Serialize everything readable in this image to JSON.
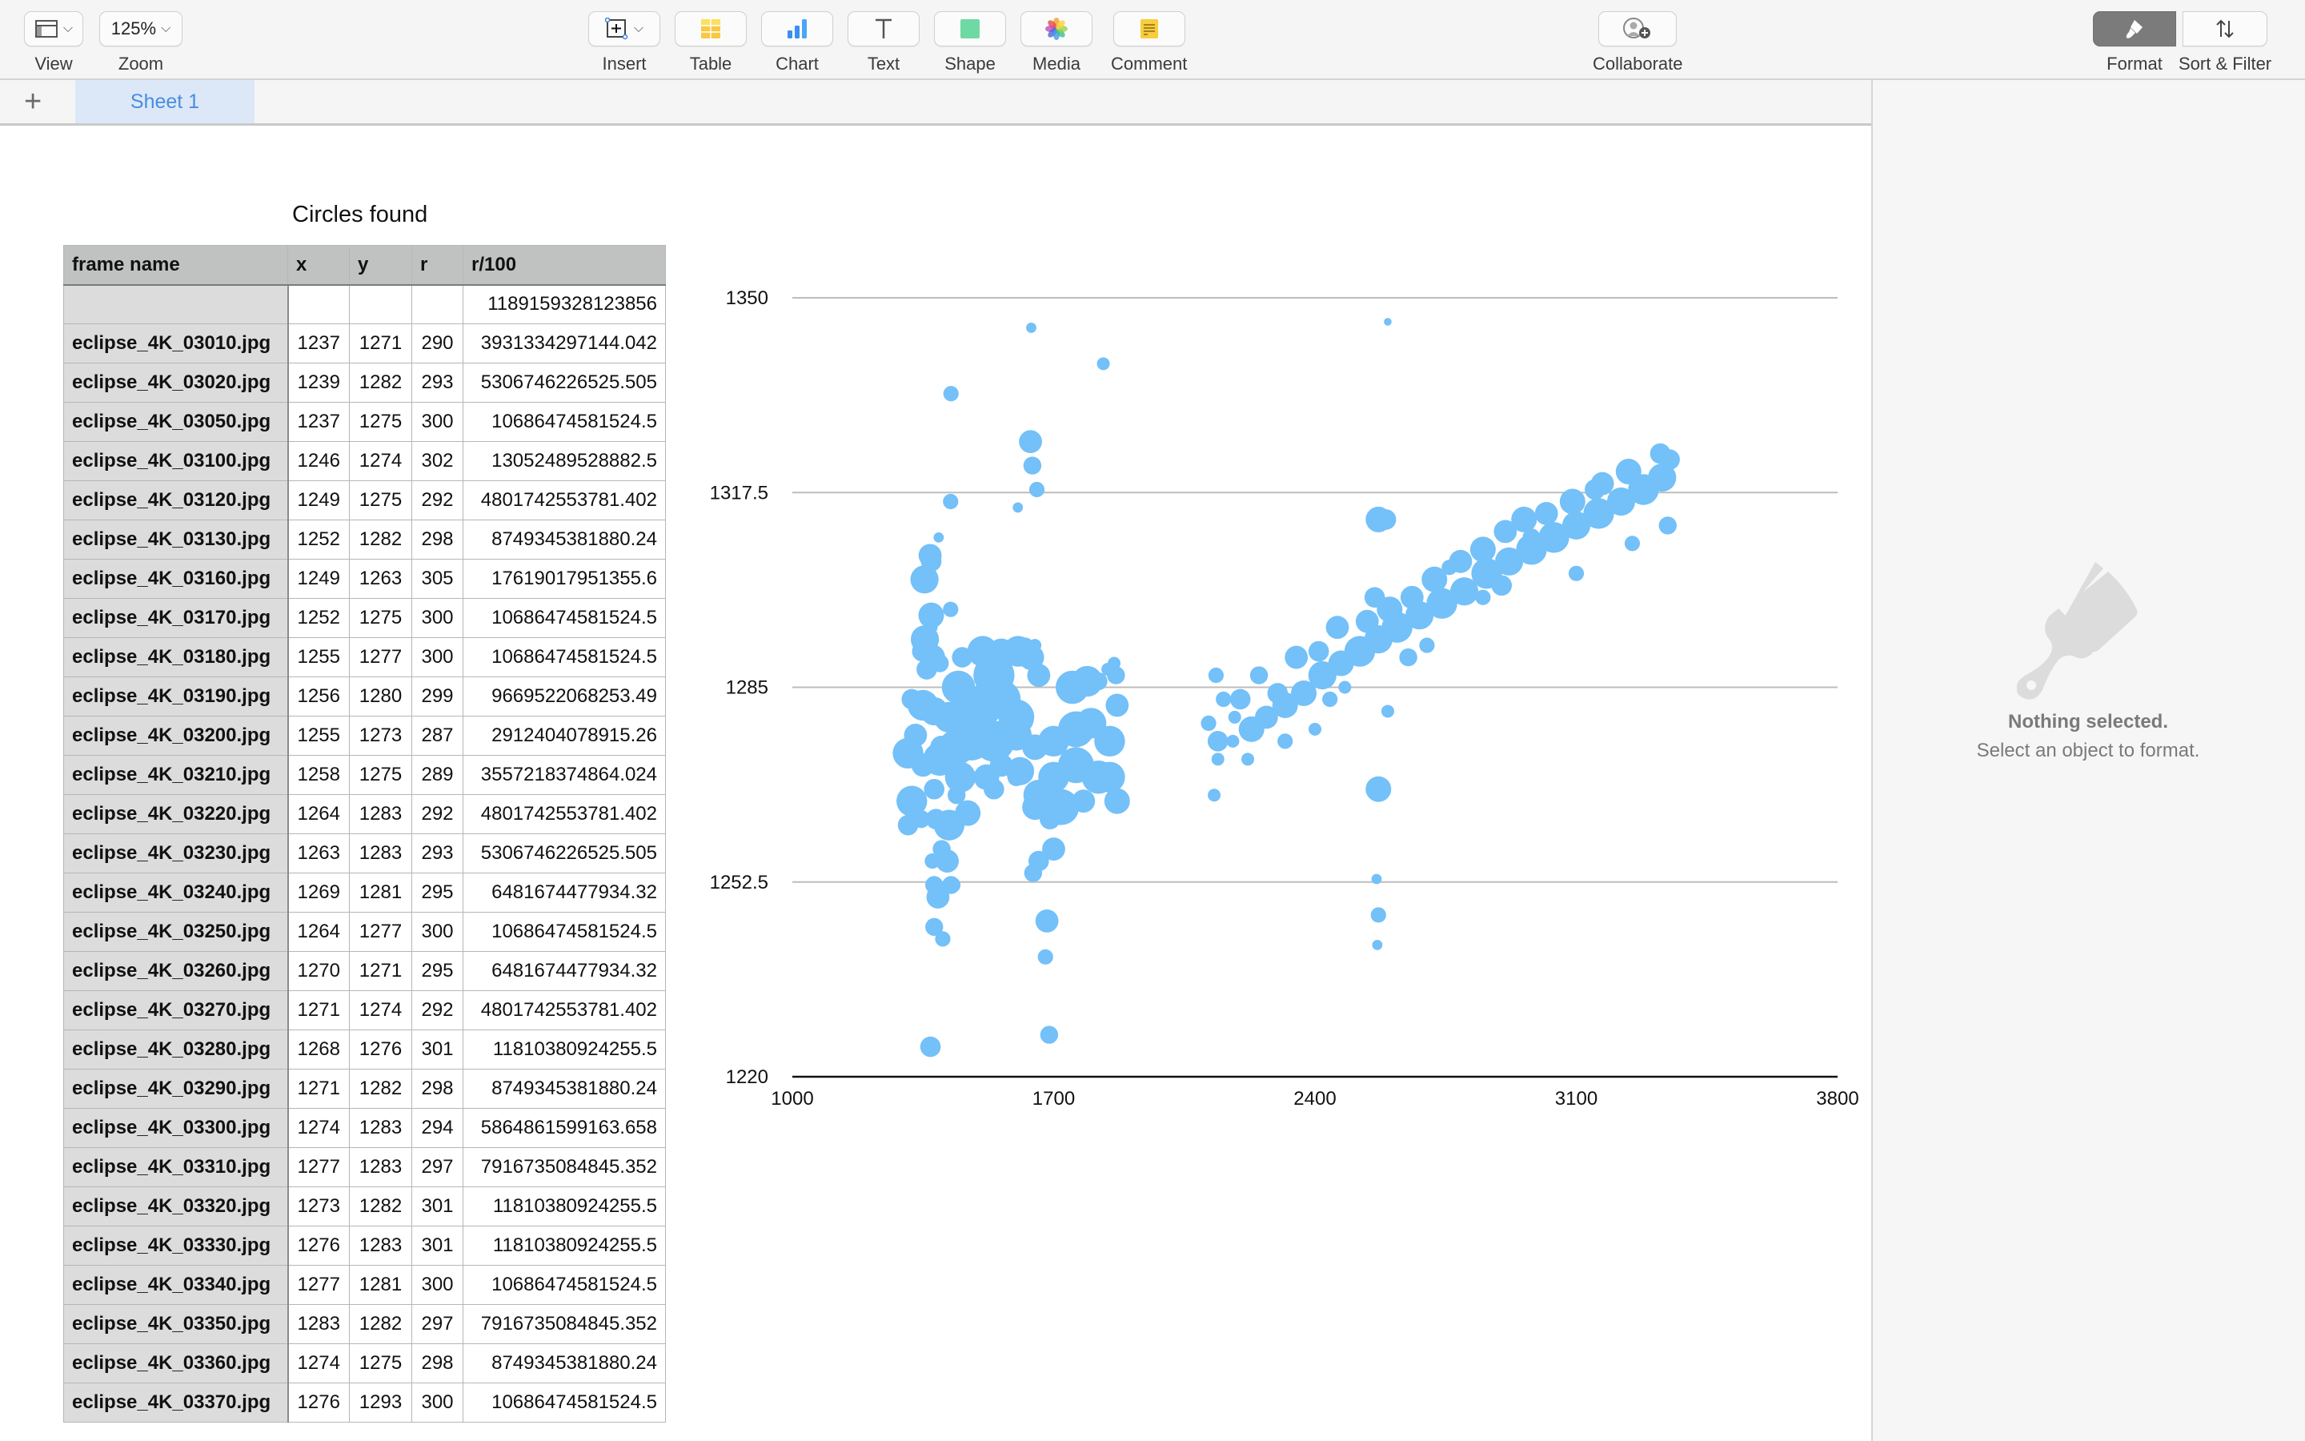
{
  "toolbar": {
    "view_label": "View",
    "zoom_value": "125%",
    "zoom_label": "Zoom",
    "insert_label": "Insert",
    "table_label": "Table",
    "chart_label": "Chart",
    "text_label": "Text",
    "shape_label": "Shape",
    "media_label": "Media",
    "comment_label": "Comment",
    "collaborate_label": "Collaborate",
    "format_label": "Format",
    "sort_filter_label": "Sort & Filter"
  },
  "sheets": {
    "add_label": "+",
    "tabs": [
      {
        "label": "Sheet 1",
        "active": true
      }
    ]
  },
  "table": {
    "title": "Circles found",
    "headers": [
      "frame name",
      "x",
      "y",
      "r",
      "r/100"
    ],
    "rows": [
      [
        "",
        "",
        "",
        "",
        "1189159328123856"
      ],
      [
        "eclipse_4K_03010.jpg",
        "1237",
        "1271",
        "290",
        "3931334297144.042"
      ],
      [
        "eclipse_4K_03020.jpg",
        "1239",
        "1282",
        "293",
        "5306746226525.505"
      ],
      [
        "eclipse_4K_03050.jpg",
        "1237",
        "1275",
        "300",
        "10686474581524.5"
      ],
      [
        "eclipse_4K_03100.jpg",
        "1246",
        "1274",
        "302",
        "13052489528882.5"
      ],
      [
        "eclipse_4K_03120.jpg",
        "1249",
        "1275",
        "292",
        "4801742553781.402"
      ],
      [
        "eclipse_4K_03130.jpg",
        "1252",
        "1282",
        "298",
        "8749345381880.24"
      ],
      [
        "eclipse_4K_03160.jpg",
        "1249",
        "1263",
        "305",
        "17619017951355.6"
      ],
      [
        "eclipse_4K_03170.jpg",
        "1252",
        "1275",
        "300",
        "10686474581524.5"
      ],
      [
        "eclipse_4K_03180.jpg",
        "1255",
        "1277",
        "300",
        "10686474581524.5"
      ],
      [
        "eclipse_4K_03190.jpg",
        "1256",
        "1280",
        "299",
        "9669522068253.49"
      ],
      [
        "eclipse_4K_03200.jpg",
        "1255",
        "1273",
        "287",
        "2912404078915.26"
      ],
      [
        "eclipse_4K_03210.jpg",
        "1258",
        "1275",
        "289",
        "3557218374864.024"
      ],
      [
        "eclipse_4K_03220.jpg",
        "1264",
        "1283",
        "292",
        "4801742553781.402"
      ],
      [
        "eclipse_4K_03230.jpg",
        "1263",
        "1283",
        "293",
        "5306746226525.505"
      ],
      [
        "eclipse_4K_03240.jpg",
        "1269",
        "1281",
        "295",
        "6481674477934.32"
      ],
      [
        "eclipse_4K_03250.jpg",
        "1264",
        "1277",
        "300",
        "10686474581524.5"
      ],
      [
        "eclipse_4K_03260.jpg",
        "1270",
        "1271",
        "295",
        "6481674477934.32"
      ],
      [
        "eclipse_4K_03270.jpg",
        "1271",
        "1274",
        "292",
        "4801742553781.402"
      ],
      [
        "eclipse_4K_03280.jpg",
        "1268",
        "1276",
        "301",
        "11810380924255.5"
      ],
      [
        "eclipse_4K_03290.jpg",
        "1271",
        "1282",
        "298",
        "8749345381880.24"
      ],
      [
        "eclipse_4K_03300.jpg",
        "1274",
        "1283",
        "294",
        "5864861599163.658"
      ],
      [
        "eclipse_4K_03310.jpg",
        "1277",
        "1283",
        "297",
        "7916735084845.352"
      ],
      [
        "eclipse_4K_03320.jpg",
        "1273",
        "1282",
        "301",
        "11810380924255.5"
      ],
      [
        "eclipse_4K_03330.jpg",
        "1276",
        "1283",
        "301",
        "11810380924255.5"
      ],
      [
        "eclipse_4K_03340.jpg",
        "1277",
        "1281",
        "300",
        "10686474581524.5"
      ],
      [
        "eclipse_4K_03350.jpg",
        "1283",
        "1282",
        "297",
        "7916735084845.352"
      ],
      [
        "eclipse_4K_03360.jpg",
        "1274",
        "1275",
        "298",
        "8749345381880.24"
      ],
      [
        "eclipse_4K_03370.jpg",
        "1276",
        "1293",
        "300",
        "10686474581524.5"
      ]
    ]
  },
  "sidebar": {
    "empty_title": "Nothing selected.",
    "empty_subtitle": "Select an object to format."
  },
  "chart_data": {
    "type": "scatter",
    "subtype": "bubble",
    "title": "",
    "xlabel": "",
    "ylabel": "",
    "xlim": [
      1000,
      3800
    ],
    "ylim": [
      1220,
      1350
    ],
    "x_ticks": [
      "1000",
      "1700",
      "2400",
      "3100",
      "3800"
    ],
    "y_ticks": [
      "1350",
      "1317.5",
      "1285",
      "1252.5",
      "1220"
    ],
    "grid": "horizontal",
    "legend": "none",
    "color": "#74c0f8",
    "series": [
      {
        "name": "circles",
        "points": [
          [
            1640,
            1345,
            4
          ],
          [
            1833,
            1339,
            5
          ],
          [
            1425,
            1334,
            6
          ],
          [
            1638,
            1326,
            9
          ],
          [
            1643,
            1322,
            7
          ],
          [
            1655,
            1318,
            6
          ],
          [
            1424,
            1316,
            6
          ],
          [
            1604,
            1315,
            4
          ],
          [
            1392,
            1310,
            4
          ],
          [
            1369,
            1307,
            9
          ],
          [
            1372,
            1306,
            8
          ],
          [
            1354,
            1303,
            11
          ],
          [
            1372,
            1297,
            10
          ],
          [
            1424,
            1298,
            6
          ],
          [
            1372,
            1295,
            5
          ],
          [
            1355,
            1293,
            11
          ],
          [
            1625,
            1292,
            6
          ],
          [
            1348,
            1291,
            8
          ],
          [
            1375,
            1290,
            10
          ],
          [
            1455,
            1290,
            8
          ],
          [
            1510,
            1291,
            12
          ],
          [
            1560,
            1291,
            10
          ],
          [
            1605,
            1291,
            12
          ],
          [
            1640,
            1290,
            10
          ],
          [
            1650,
            1292,
            5
          ],
          [
            1360,
            1288,
            8
          ],
          [
            1395,
            1289,
            7
          ],
          [
            1445,
            1285,
            13
          ],
          [
            1540,
            1287,
            16
          ],
          [
            1660,
            1287,
            9
          ],
          [
            1750,
            1285,
            13
          ],
          [
            1790,
            1286,
            12
          ],
          [
            1820,
            1286,
            7
          ],
          [
            1845,
            1288,
            5
          ],
          [
            1862,
            1289,
            5
          ],
          [
            1867,
            1287,
            7
          ],
          [
            1870,
            1282,
            9
          ],
          [
            1320,
            1283,
            8
          ],
          [
            1350,
            1282,
            12
          ],
          [
            1380,
            1281,
            11
          ],
          [
            1420,
            1280,
            12
          ],
          [
            1470,
            1280,
            14
          ],
          [
            1510,
            1282,
            16
          ],
          [
            1560,
            1283,
            15
          ],
          [
            1600,
            1280,
            14
          ],
          [
            1700,
            1276,
            12
          ],
          [
            1760,
            1278,
            14
          ],
          [
            1800,
            1279,
            12
          ],
          [
            1850,
            1276,
            12
          ],
          [
            1330,
            1277,
            9
          ],
          [
            1400,
            1275,
            9
          ],
          [
            1440,
            1275,
            14
          ],
          [
            1480,
            1276,
            15
          ],
          [
            1540,
            1276,
            16
          ],
          [
            1600,
            1277,
            12
          ],
          [
            1650,
            1275,
            10
          ],
          [
            1700,
            1270,
            12
          ],
          [
            1760,
            1272,
            14
          ],
          [
            1820,
            1270,
            13
          ],
          [
            1310,
            1274,
            12
          ],
          [
            1350,
            1272,
            9
          ],
          [
            1395,
            1273,
            13
          ],
          [
            1450,
            1270,
            12
          ],
          [
            1520,
            1270,
            10
          ],
          [
            1560,
            1272,
            9
          ],
          [
            1610,
            1271,
            11
          ],
          [
            1660,
            1267,
            12
          ],
          [
            1720,
            1265,
            14
          ],
          [
            1780,
            1266,
            9
          ],
          [
            1850,
            1270,
            12
          ],
          [
            1870,
            1266,
            10
          ],
          [
            1320,
            1266,
            12
          ],
          [
            1380,
            1268,
            8
          ],
          [
            1420,
            1262,
            12
          ],
          [
            1470,
            1264,
            10
          ],
          [
            1540,
            1268,
            8
          ],
          [
            1600,
            1270,
            7
          ],
          [
            1310,
            1262,
            8
          ],
          [
            1345,
            1263,
            7
          ],
          [
            1385,
            1263,
            8
          ],
          [
            1400,
            1258,
            7
          ],
          [
            1415,
            1256,
            9
          ],
          [
            1440,
            1267,
            7
          ],
          [
            1650,
            1265,
            10
          ],
          [
            1690,
            1263,
            8
          ],
          [
            1700,
            1258,
            9
          ],
          [
            1660,
            1256,
            8
          ],
          [
            1645,
            1254,
            7
          ],
          [
            1375,
            1256,
            6
          ],
          [
            1380,
            1252,
            7
          ],
          [
            1425,
            1252,
            7
          ],
          [
            1430,
            1252,
            6
          ],
          [
            1390,
            1250,
            9
          ],
          [
            1682,
            1246,
            9
          ],
          [
            1380,
            1245,
            7
          ],
          [
            1403,
            1243,
            6
          ],
          [
            1678,
            1240,
            6
          ],
          [
            1370,
            1225,
            8
          ],
          [
            1688,
            1227,
            7
          ],
          [
            2595,
            1346,
            3
          ],
          [
            2135,
            1287,
            6
          ],
          [
            2155,
            1283,
            6
          ],
          [
            2115,
            1279,
            6
          ],
          [
            2140,
            1276,
            8
          ],
          [
            2180,
            1276,
            5
          ],
          [
            2230,
            1278,
            10
          ],
          [
            2270,
            1280,
            9
          ],
          [
            2320,
            1282,
            10
          ],
          [
            2370,
            1284,
            10
          ],
          [
            2420,
            1287,
            11
          ],
          [
            2470,
            1289,
            10
          ],
          [
            2520,
            1291,
            12
          ],
          [
            2570,
            1293,
            11
          ],
          [
            2620,
            1295,
            12
          ],
          [
            2680,
            1297,
            11
          ],
          [
            2740,
            1299,
            12
          ],
          [
            2800,
            1301,
            11
          ],
          [
            2860,
            1304,
            12
          ],
          [
            2920,
            1306,
            11
          ],
          [
            2980,
            1308,
            12
          ],
          [
            3040,
            1310,
            12
          ],
          [
            3100,
            1312,
            11
          ],
          [
            3160,
            1314,
            12
          ],
          [
            3220,
            1316,
            11
          ],
          [
            3280,
            1318,
            12
          ],
          [
            3330,
            1320,
            11
          ],
          [
            3350,
            1323,
            8
          ],
          [
            3325,
            1324,
            8
          ],
          [
            3345,
            1312,
            7
          ],
          [
            3250,
            1309,
            6
          ],
          [
            3150,
            1318,
            8
          ],
          [
            3100,
            1304,
            6
          ],
          [
            2980,
            1310,
            7
          ],
          [
            2900,
            1302,
            8
          ],
          [
            2850,
            1300,
            6
          ],
          [
            2760,
            1305,
            6
          ],
          [
            2700,
            1292,
            6
          ],
          [
            2650,
            1290,
            7
          ],
          [
            2560,
            1300,
            8
          ],
          [
            2570,
            1313,
            10
          ],
          [
            2590,
            1313,
            8
          ],
          [
            2480,
            1285,
            5
          ],
          [
            2440,
            1283,
            6
          ],
          [
            2400,
            1278,
            5
          ],
          [
            2320,
            1276,
            6
          ],
          [
            2220,
            1273,
            5
          ],
          [
            2185,
            1280,
            5
          ],
          [
            2140,
            1273,
            5
          ],
          [
            2595,
            1281,
            5
          ],
          [
            2130,
            1267,
            5
          ],
          [
            2570,
            1268,
            10
          ],
          [
            2565,
            1253,
            4
          ],
          [
            2570,
            1247,
            6
          ],
          [
            2567,
            1242,
            4
          ],
          [
            2200,
            1283,
            8
          ],
          [
            2250,
            1287,
            7
          ],
          [
            2300,
            1284,
            8
          ],
          [
            2350,
            1290,
            9
          ],
          [
            2410,
            1291,
            8
          ],
          [
            2460,
            1295,
            9
          ],
          [
            2540,
            1296,
            9
          ],
          [
            2600,
            1298,
            10
          ],
          [
            2660,
            1300,
            9
          ],
          [
            2720,
            1303,
            10
          ],
          [
            2790,
            1306,
            9
          ],
          [
            2850,
            1308,
            10
          ],
          [
            2910,
            1311,
            9
          ],
          [
            2960,
            1313,
            10
          ],
          [
            3020,
            1314,
            9
          ],
          [
            3090,
            1316,
            10
          ],
          [
            3170,
            1319,
            9
          ],
          [
            3240,
            1321,
            10
          ]
        ]
      }
    ]
  }
}
